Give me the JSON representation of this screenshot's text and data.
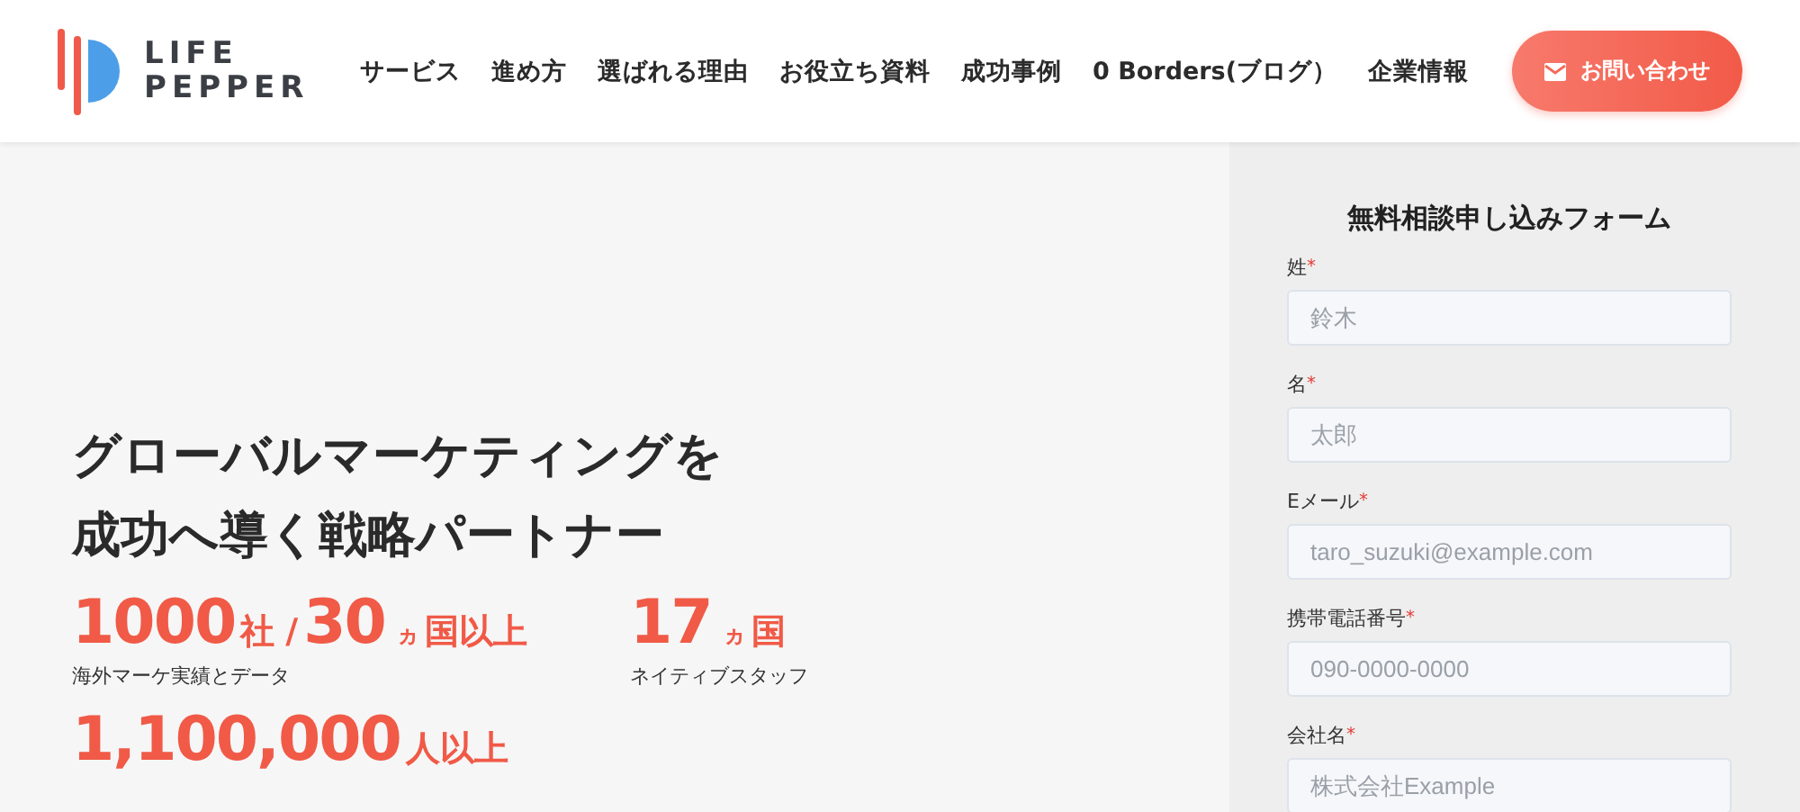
{
  "header": {
    "logo": {
      "line_1": "LIFE",
      "line_2": "PEPPER"
    },
    "nav": [
      "サービス",
      "進め方",
      "選ばれる理由",
      "お役立ち資料",
      "成功事例",
      "0 Borders(ブログ）",
      "企業情報"
    ],
    "contact_button": "お問い合わせ"
  },
  "hero": {
    "headline": [
      "グローバルマーケティングを",
      "成功へ導く戦略パートナー"
    ],
    "stats": [
      {
        "parts": [
          {
            "kind": "number",
            "text": "1000"
          },
          {
            "kind": "unit",
            "text": "社"
          },
          {
            "kind": "unit",
            "text": "/"
          },
          {
            "kind": "number",
            "text": "30"
          },
          {
            "kind": "small",
            "text": "ヵ"
          },
          {
            "kind": "unit",
            "text": "国以上"
          }
        ],
        "caption": "海外マーケ実績とデータ"
      },
      {
        "parts": [
          {
            "kind": "number",
            "text": "17"
          },
          {
            "kind": "small",
            "text": "ヵ"
          },
          {
            "kind": "unit",
            "text": "国"
          }
        ],
        "caption": "ネイティブスタッフ"
      },
      {
        "parts": [
          {
            "kind": "number",
            "text": "1,100,000"
          },
          {
            "kind": "unit",
            "text": "人以上"
          }
        ]
      }
    ]
  },
  "form": {
    "title": "無料相談申し込みフォーム",
    "fields": [
      {
        "label": "姓",
        "required_mark": "*",
        "placeholder": "鈴木"
      },
      {
        "label": "名",
        "required_mark": "*",
        "placeholder": "太郎"
      },
      {
        "label": "Eメール",
        "required_mark": "*",
        "placeholder": "taro_suzuki@example.com"
      },
      {
        "label": "携帯電話番号",
        "required_mark": "*",
        "placeholder": "090-0000-0000"
      },
      {
        "label": "会社名",
        "required_mark": "*",
        "placeholder": "株式会社Example"
      }
    ]
  }
}
